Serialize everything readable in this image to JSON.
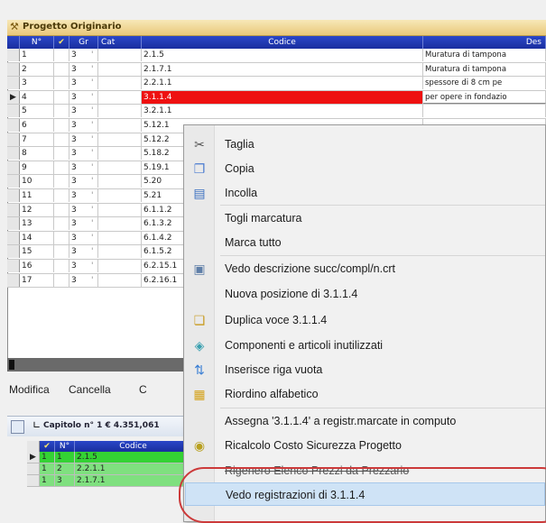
{
  "window": {
    "title": "Progetto Originario"
  },
  "columns": {
    "sel": "",
    "n": "N°",
    "v": "✔",
    "gr": "Gr",
    "cat": "Cat",
    "codice": "Codice",
    "desc": "Des"
  },
  "rows": [
    {
      "marker": "",
      "n": "1",
      "gr": "3",
      "tick": "'",
      "codice": "2.1.5",
      "desc": "Muratura di tampona"
    },
    {
      "marker": "",
      "n": "2",
      "gr": "3",
      "tick": "'",
      "codice": "2.1.7.1",
      "desc": "Muratura di tampona"
    },
    {
      "marker": "",
      "n": "3",
      "gr": "3",
      "tick": "'",
      "codice": "2.2.1.1",
      "desc": "spessore di 8 cm pe"
    },
    {
      "marker": "▶",
      "n": "4",
      "gr": "3",
      "tick": "'",
      "codice": "3.1.1.4",
      "desc": "per opere in fondazio"
    },
    {
      "marker": "",
      "n": "5",
      "gr": "3",
      "tick": "'",
      "codice": "3.2.1.1",
      "desc": ""
    },
    {
      "marker": "",
      "n": "6",
      "gr": "3",
      "tick": "'",
      "codice": "5.12.1",
      "desc": ""
    },
    {
      "marker": "",
      "n": "7",
      "gr": "3",
      "tick": "'",
      "codice": "5.12.2",
      "desc": ""
    },
    {
      "marker": "",
      "n": "8",
      "gr": "3",
      "tick": "'",
      "codice": "5.18.2",
      "desc": ""
    },
    {
      "marker": "",
      "n": "9",
      "gr": "3",
      "tick": "'",
      "codice": "5.19.1",
      "desc": ""
    },
    {
      "marker": "",
      "n": "10",
      "gr": "3",
      "tick": "'",
      "codice": "5.20",
      "desc": ""
    },
    {
      "marker": "",
      "n": "11",
      "gr": "3",
      "tick": "'",
      "codice": "5.21",
      "desc": ""
    },
    {
      "marker": "",
      "n": "12",
      "gr": "3",
      "tick": "'",
      "codice": "6.1.1.2",
      "desc": ""
    },
    {
      "marker": "",
      "n": "13",
      "gr": "3",
      "tick": "'",
      "codice": "6.1.3.2",
      "desc": ""
    },
    {
      "marker": "",
      "n": "14",
      "gr": "3",
      "tick": "'",
      "codice": "6.1.4.2",
      "desc": ""
    },
    {
      "marker": "",
      "n": "15",
      "gr": "3",
      "tick": "'",
      "codice": "6.1.5.2",
      "desc": ""
    },
    {
      "marker": "",
      "n": "16",
      "gr": "3",
      "tick": "'",
      "codice": "6.2.15.1",
      "desc": ""
    },
    {
      "marker": "",
      "n": "17",
      "gr": "3",
      "tick": "'",
      "codice": "6.2.16.1",
      "desc": ""
    }
  ],
  "actions": {
    "modifica": "Modifica",
    "cancella": "Cancella",
    "c": "C"
  },
  "sub": {
    "title": "Capitolo n° 1 € 4.351,061",
    "columns": {
      "sel": "",
      "v": "✔",
      "n": "N°",
      "codice": "Codice"
    },
    "rows": [
      {
        "marker": "▶",
        "v": "1",
        "n": "1",
        "codice": "2.1.5"
      },
      {
        "marker": "",
        "v": "1",
        "n": "2",
        "codice": "2.2.1.1"
      },
      {
        "marker": "",
        "v": "1",
        "n": "3",
        "codice": "2.1.7.1"
      }
    ]
  },
  "menu": [
    {
      "label": "Taglia",
      "icon": "scissors-icon",
      "glyph": "✂",
      "color": "#555"
    },
    {
      "label": "Copia",
      "icon": "copy-icon",
      "glyph": "❐",
      "color": "#4a7bd0"
    },
    {
      "label": "Incolla",
      "icon": "paste-icon",
      "glyph": "▤",
      "color": "#3a6fc0"
    },
    {
      "label": "Togli marcatura",
      "icon": "",
      "glyph": "",
      "color": "#000"
    },
    {
      "label": "Marca tutto",
      "icon": "",
      "glyph": "",
      "color": "#000"
    },
    {
      "label": "Vedo descrizione succ/compl/n.crt",
      "icon": "document-icon",
      "glyph": "▣",
      "color": "#5f7fa8"
    },
    {
      "label": "Nuova posizione di  3.1.1.4",
      "icon": "",
      "glyph": "",
      "color": "#000"
    },
    {
      "label": "Duplica voce 3.1.1.4",
      "icon": "duplicate-icon",
      "glyph": "❏",
      "color": "#c89a1e"
    },
    {
      "label": "Componenti e articoli inutilizzati",
      "icon": "components-icon",
      "glyph": "◈",
      "color": "#3aa0b0"
    },
    {
      "label": "Inserisce riga vuota",
      "icon": "insert-row-icon",
      "glyph": "⇅",
      "color": "#3b7fd4"
    },
    {
      "label": "Riordino alfabetico",
      "icon": "sort-icon",
      "glyph": "▦",
      "color": "#d4a21a"
    },
    {
      "label": "Assegna '3.1.1.4' a registr.marcate in  computo",
      "icon": "",
      "glyph": "",
      "color": "#000"
    },
    {
      "label": "Ricalcolo Costo Sicurezza Progetto",
      "icon": "recalc-icon",
      "glyph": "◉",
      "color": "#b8a020"
    },
    {
      "label": "Rigenero Elenco Prezzi da Prezzario",
      "icon": "",
      "glyph": "",
      "color": "#000"
    },
    {
      "label": "Vedo registrazioni di 3.1.1.4",
      "icon": "",
      "glyph": "",
      "color": "#000"
    }
  ],
  "colors": {
    "header": "#1f36b5",
    "selected_code": "#ee1111",
    "highlight": "#cfe3f6",
    "ring": "#cc3a3a",
    "sub_green": "#34d234"
  }
}
